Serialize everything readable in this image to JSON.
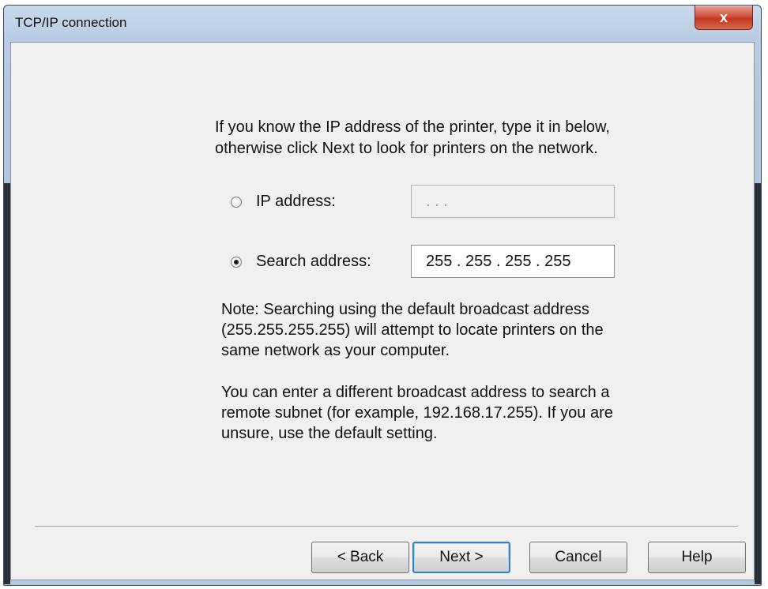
{
  "window": {
    "title": "TCP/IP connection",
    "close_glyph": "x"
  },
  "intro": {
    "line1": "If you know the IP address of the printer, type it in below,",
    "line2": "otherwise click Next to look for printers on the network."
  },
  "options": {
    "ip_address": {
      "label": "IP address:",
      "value": ".   .   .",
      "selected": false,
      "enabled": false
    },
    "search_address": {
      "label": "Search address:",
      "value": "255 . 255 . 255 . 255",
      "selected": true,
      "enabled": true
    }
  },
  "notes": {
    "note1": [
      "Note: Searching using the default broadcast address",
      "(255.255.255.255) will attempt to locate printers on the",
      "same network as your computer."
    ],
    "note2": [
      "You can enter a different broadcast address to search a",
      "remote subnet (for example, 192.168.17.255). If you are",
      "unsure, use the default setting."
    ]
  },
  "buttons": {
    "back": "< Back",
    "next": "Next >",
    "cancel": "Cancel",
    "help": "Help"
  },
  "colors": {
    "titlebar": "#b7cbe3",
    "close_button": "#c2371f",
    "dialog_background": "#f0f0f0",
    "default_button_border": "#3c7fb1"
  }
}
